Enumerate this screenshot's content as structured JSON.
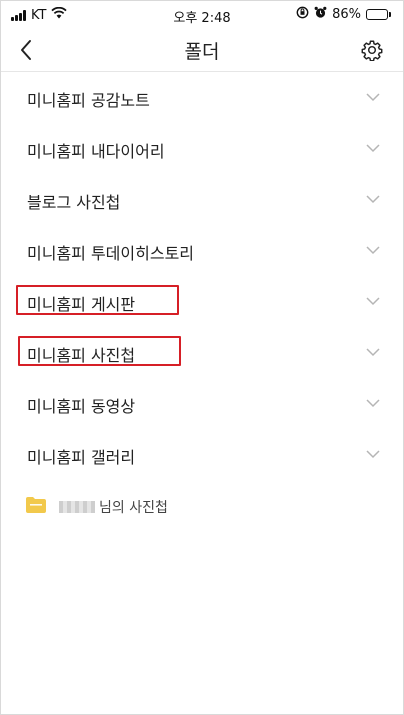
{
  "status_bar": {
    "carrier": "KT",
    "time": "오후 2:48",
    "battery_text": "86%",
    "battery_level": 0.86
  },
  "header": {
    "title": "폴더",
    "back_icon": "back-chevron-icon",
    "settings_icon": "gear-icon"
  },
  "folders": [
    {
      "label": "미니홈피 공감노트",
      "highlighted": false
    },
    {
      "label": "미니홈피 내다이어리",
      "highlighted": false
    },
    {
      "label": "블로그 사진첩",
      "highlighted": false
    },
    {
      "label": "미니홈피 투데이히스토리",
      "highlighted": false
    },
    {
      "label": "미니홈피 게시판",
      "highlighted": true
    },
    {
      "label": "미니홈피 사진첩",
      "highlighted": true
    },
    {
      "label": "미니홈피 동영상",
      "highlighted": false
    },
    {
      "label": "미니홈피 갤러리",
      "highlighted": false
    }
  ],
  "user_album": {
    "label": "님의 사진첩",
    "icon": "folder-icon"
  },
  "colors": {
    "highlight_border": "#d61f26",
    "folder_yellow": "#f2c94c",
    "chevron": "#b5b5b5"
  }
}
